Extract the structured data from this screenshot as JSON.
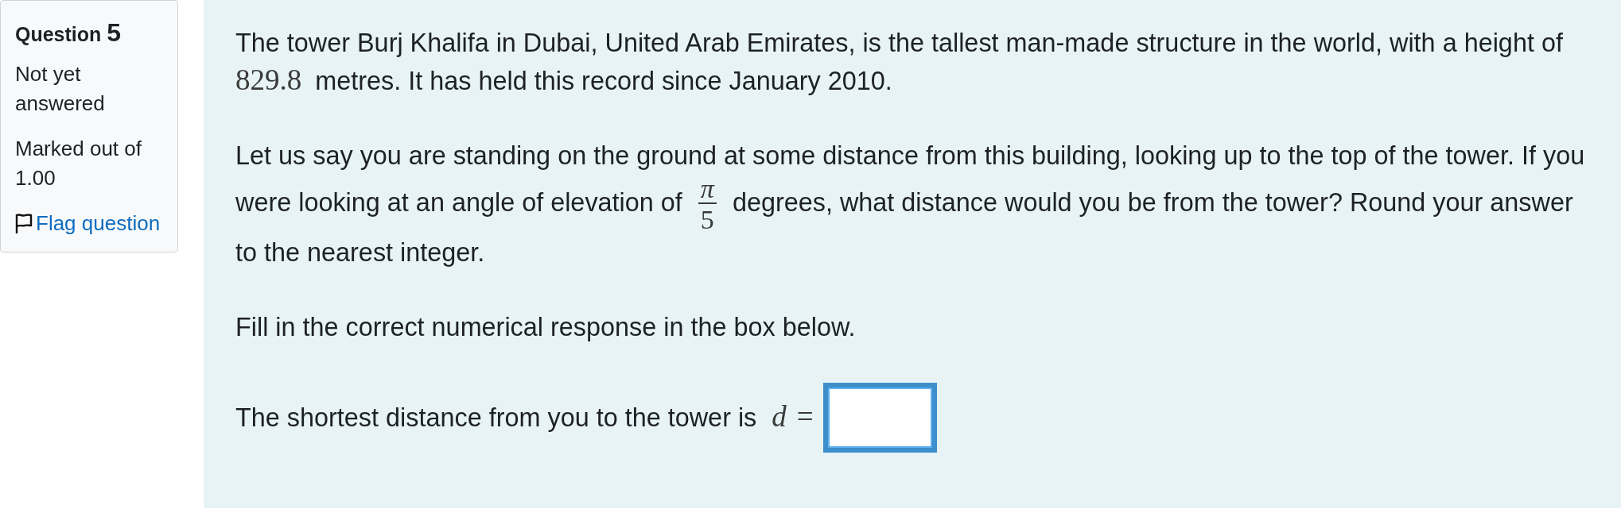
{
  "question_info": {
    "label": "Question",
    "number": "5",
    "state": "Not yet answered",
    "grade": "Marked out of 1.00",
    "flag": {
      "label": "Flag question",
      "flagged": false
    }
  },
  "question_text": {
    "paragraphs": [
      [
        {
          "kind": "text",
          "text": "The tower Burj Khalifa in Dubai, United Arab Emirates, is the tallest man-made structure in the world, with a height of"
        },
        {
          "kind": "math",
          "text": "829.8"
        },
        {
          "kind": "text",
          "text": "metres. It has held this record since January 2010."
        }
      ],
      [
        {
          "kind": "text",
          "text": "Let us say you are standing on the ground at some distance from this building, looking up to the top of the tower. If you were looking at an angle of elevation of"
        },
        {
          "kind": "fraction",
          "numerator": "π",
          "denominator": "5"
        },
        {
          "kind": "text",
          "text": "degrees, what distance would you be from the tower? Round your answer to the nearest integer."
        }
      ],
      [
        {
          "kind": "text",
          "text": "Fill in the correct numerical response in the box below."
        }
      ]
    ]
  },
  "answer": {
    "prompt": [
      {
        "kind": "text",
        "text": "The shortest distance from you to the tower is"
      },
      {
        "kind": "variable",
        "text": "d"
      },
      {
        "kind": "math",
        "text": "="
      }
    ],
    "field": {
      "focused": true
    }
  }
}
